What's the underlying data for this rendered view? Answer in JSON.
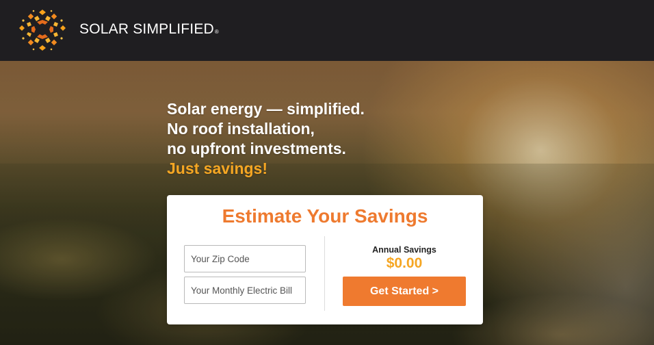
{
  "brand": {
    "name": "SOLAR SIMPLIFIED",
    "registered_mark": "®",
    "logo_icon": "sun-icon",
    "colors": {
      "orange": "#ee7a2f",
      "yellow": "#f5a623",
      "topbar": "#1f1e21"
    }
  },
  "hero": {
    "headline_lines": [
      "Solar energy — simplified.",
      "No roof installation,",
      "no upfront investments."
    ],
    "headline_accent": "Just savings!"
  },
  "estimator": {
    "title": "Estimate Your Savings",
    "zip_placeholder": "Your Zip Code",
    "zip_value": "",
    "bill_placeholder": "Your Monthly Electric Bill",
    "bill_value": "",
    "savings_label": "Annual Savings",
    "savings_value": "$0.00",
    "cta_label": "Get Started >"
  }
}
